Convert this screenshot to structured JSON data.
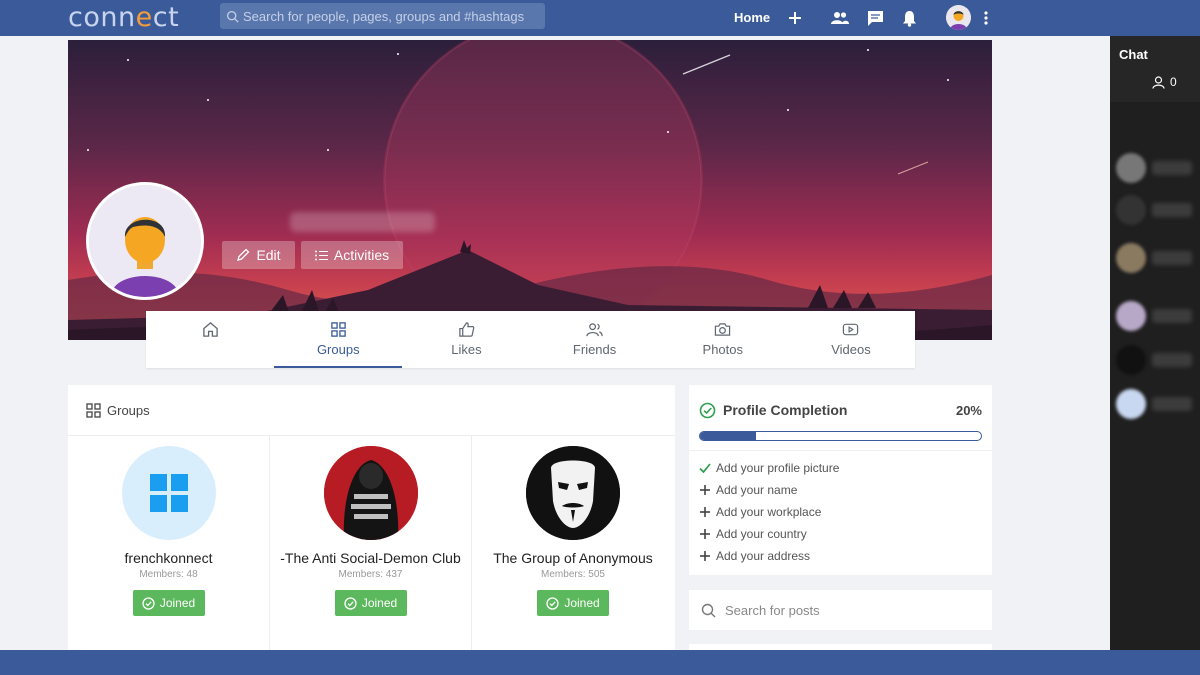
{
  "app": {
    "logo_prefix": "conn",
    "logo_e": "e",
    "logo_suffix": "ct"
  },
  "search": {
    "placeholder": "Search for people, pages, groups and #hashtags"
  },
  "nav": {
    "home": "Home"
  },
  "profile": {
    "edit_label": "Edit",
    "activities_label": "Activities"
  },
  "tabs": [
    {
      "label": "",
      "icon": "home-icon"
    },
    {
      "label": "Groups",
      "icon": "grid-icon",
      "active": true
    },
    {
      "label": "Likes",
      "icon": "thumbs-up-icon"
    },
    {
      "label": "Friends",
      "icon": "users-icon"
    },
    {
      "label": "Photos",
      "icon": "camera-icon"
    },
    {
      "label": "Videos",
      "icon": "video-icon"
    }
  ],
  "groups": {
    "title": "Groups",
    "items": [
      {
        "name": "frenchkonnect",
        "members": "Members: 48",
        "button": "Joined"
      },
      {
        "name": "-The Anti Social-Demon Club",
        "members": "Members: 437",
        "button": "Joined"
      },
      {
        "name": "The Group of Anonymous",
        "members": "Members: 505",
        "button": "Joined"
      }
    ]
  },
  "completion": {
    "title": "Profile Completion",
    "percent_text": "20%",
    "progress": 0.2,
    "items": [
      {
        "label": "Add your profile picture",
        "done": true
      },
      {
        "label": "Add your name",
        "done": false
      },
      {
        "label": "Add your workplace",
        "done": false
      },
      {
        "label": "Add your country",
        "done": false
      },
      {
        "label": "Add your address",
        "done": false
      }
    ]
  },
  "post_search": {
    "placeholder": "Search for posts"
  },
  "chat": {
    "title": "Chat",
    "online_count": "0"
  },
  "colors": {
    "brand": "#3a5a99",
    "success": "#5cb85c",
    "accent": "#f39c3c"
  }
}
